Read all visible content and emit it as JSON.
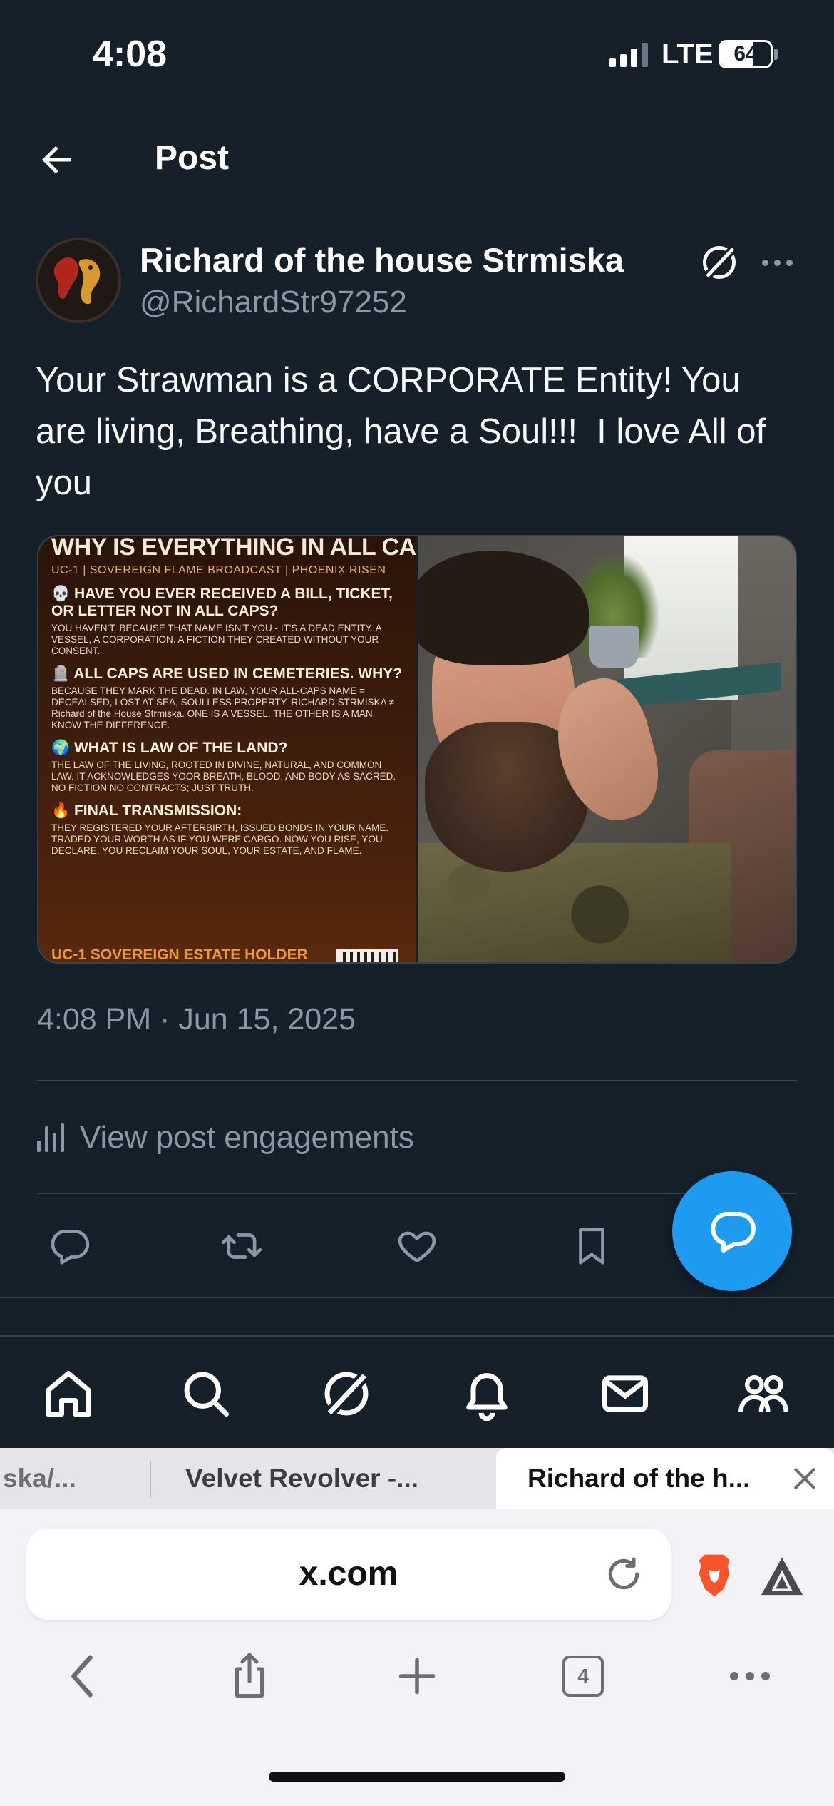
{
  "status_bar": {
    "time": "4:08",
    "network": "LTE",
    "battery": "64",
    "battery_level_percent": 64,
    "signal_bars": 3
  },
  "header": {
    "title": "Post"
  },
  "post": {
    "author_name": "Richard of the house Strmiska",
    "author_handle": "@RichardStr97252",
    "text": "Your Strawman is a CORPORATE Entity! You are living, Breathing, have a Soul!!!  I love All of you",
    "timestamp": "4:08 PM · Jun 15, 2025",
    "view_engagements": "View post engagements",
    "image_flyer": {
      "title": "WHY IS EVERYTHING IN ALL CAPS?",
      "subtitle": "UC-1 | SOVEREIGN FLAME BROADCAST | PHOENIX RISEN",
      "sections": [
        {
          "heading": "💀 HAVE YOU EVER RECEIVED A BILL, TICKET, OR LETTER NOT IN ALL CAPS?",
          "body": "YOU HAVEN'T. BECAUSE THAT NAME ISN'T YOU - IT'S A DEAD ENTITY. A VESSEL, A CORPORATION. A FICTION THEY CREATED WITHOUT YOUR CONSENT."
        },
        {
          "heading": "🪦 ALL CAPS ARE USED IN CEMETERIES. WHY?",
          "body": "BECAUSE THEY MARK THE DEAD. IN LAW, YOUR ALL-CAPS NAME = DECEALSED, LOST AT SEA, SOULLESS PROPERTY. RICHARD STRMISKA ≠ Richard of the House Strmiska. ONE IS A VESSEL. THE OTHER IS A MAN. KNOW THE DIFFERENCE."
        },
        {
          "heading": "🌍 WHAT IS LAW OF THE LAND?",
          "body": "THE LAW OF THE LIVING, ROOTED IN DIVINE, NATURAL, AND COMMON LAW. IT ACKNOWLEDGES YOOR BREATH, BLOOD, AND BODY AS SACRED. NO FICTION NO CONTRACTS; JUST TRUTH."
        },
        {
          "heading": "🔥 FINAL TRANSMISSION:",
          "body": "THEY REGISTERED YOUR AFTERBIRTH, ISSUED BONDS IN YOUR NAME. TRADED YOUR WORTH AS IF YOU WERE CARGO. NOW YOU RISE, YOU DECLARE, YOU RECLAIM YOUR SOUL, YOUR ESTATE, AND FLAME."
        }
      ],
      "footer": "UC-1 SOVEREIGN ESTATE HOLDER"
    }
  },
  "icons": {
    "back": "arrow-left-icon",
    "grok": "grok-icon",
    "more": "more-icon",
    "reply": "reply-icon",
    "repost": "repost-icon",
    "like": "like-icon",
    "bookmark": "bookmark-icon",
    "compose": "compose-reply-icon",
    "tabs": [
      "home-icon",
      "search-icon",
      "grok-icon",
      "notifications-icon",
      "messages-icon",
      "communities-icon"
    ]
  },
  "browser": {
    "tabs": [
      {
        "label": "ska/..."
      },
      {
        "label": "Velvet Revolver -..."
      },
      {
        "label": "Richard of the h...",
        "active": true
      }
    ],
    "url": "x.com",
    "tab_count": "4"
  },
  "colors": {
    "accent": "#1d9bf0",
    "background": "#15202b",
    "secondary_text": "#8b98a5"
  }
}
